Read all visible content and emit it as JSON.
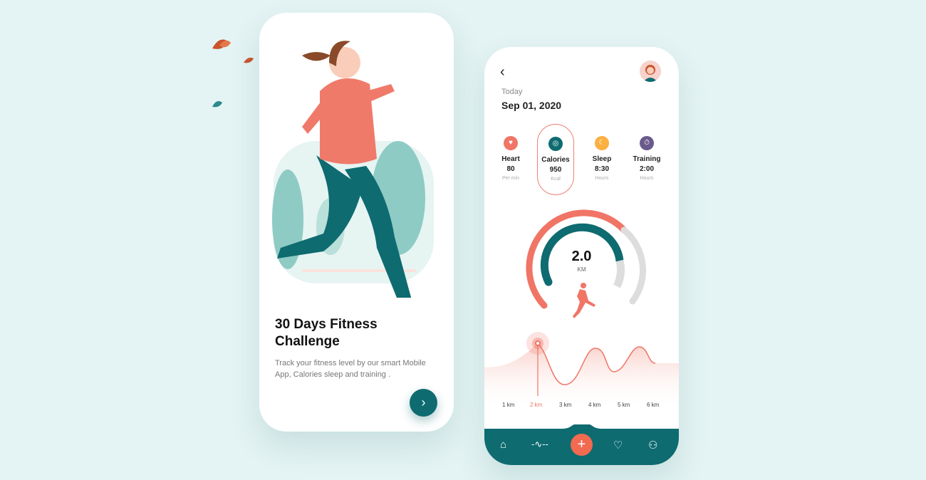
{
  "onboarding": {
    "title": "30 Days Fitness Challenge",
    "description": "Track your fitness level by our smart Mobile App, Calories sleep and training .",
    "next_icon": "chevron-right-icon"
  },
  "dashboard": {
    "back_icon": "chevron-left-icon",
    "day_label": "Today",
    "date": "Sep 01, 2020",
    "stats": [
      {
        "label": "Heart",
        "value": "80",
        "unit": "Per min",
        "icon": "heart-icon",
        "color": "#f07566"
      },
      {
        "label": "Calories",
        "value": "950",
        "unit": "Kcal",
        "icon": "target-icon",
        "color": "#0e6b70",
        "selected": true
      },
      {
        "label": "Sleep",
        "value": "8:30",
        "unit": "Hours",
        "icon": "moon-icon",
        "color": "#fbb040"
      },
      {
        "label": "Training",
        "value": "2:00",
        "unit": "Hours",
        "icon": "stopwatch-icon",
        "color": "#6a5a8c"
      }
    ],
    "distance": {
      "value": "2.0",
      "unit": "KM"
    },
    "km_labels": [
      "1 km",
      "2 km",
      "3 km",
      "4 km",
      "5 km",
      "6 km"
    ],
    "active_km": "2 km",
    "nav": [
      "home-icon",
      "activity-icon",
      "plus-icon",
      "heart-icon",
      "user-icon"
    ],
    "colors": {
      "teal": "#0e6b70",
      "coral": "#f07566"
    }
  }
}
